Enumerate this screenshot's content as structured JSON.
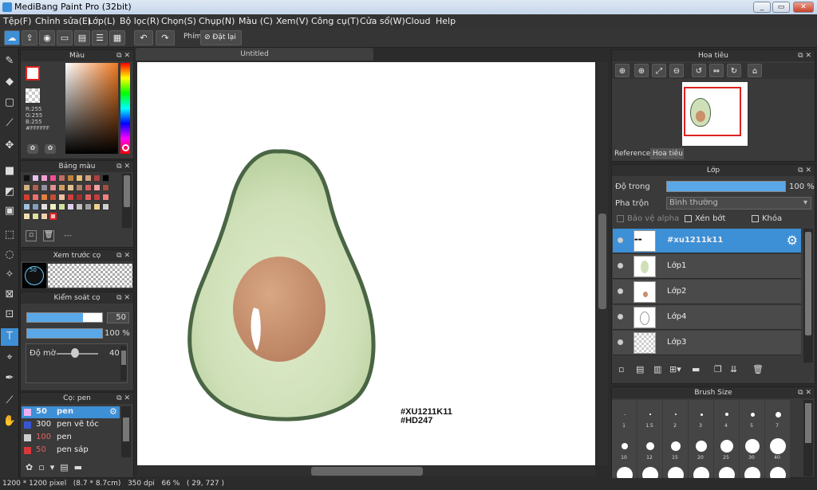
{
  "window": {
    "title": "MediBang Paint Pro (32bit)",
    "min": "_",
    "max": "▭",
    "close": "✕"
  },
  "menu": [
    "Tệp(F)",
    "Chỉnh sửa(E)",
    "Lớp(L)",
    "Bộ lọc(R)",
    "Chọn(S)",
    "Chụp(N)",
    "Màu (C)",
    "Xem(V)",
    "Công cụ(T)",
    "Cửa sổ(W)",
    "Cloud",
    "Help"
  ],
  "toolbar": {
    "key_label": "Phím",
    "reset_label": "Đặt lại"
  },
  "color_panel": {
    "title": "Màu",
    "r": "R:255",
    "g": "G:255",
    "b": "B:255",
    "hex": "#FFFFFF"
  },
  "palette_panel": {
    "title": "Bảng màu",
    "placeholder": "---"
  },
  "brush_preview": {
    "title": "Xem trước cọ",
    "size": "50"
  },
  "brush_control": {
    "title": "Kiểm soát cọ",
    "size": "50",
    "opacity": "100 %",
    "blur_label": "Độ mờ",
    "blur_value": "40"
  },
  "brush_list": {
    "title": "Cọ: pen",
    "items": [
      {
        "size": "50",
        "name": "pen",
        "color": "#f0b0f0"
      },
      {
        "size": "300",
        "name": "pen vẽ tóc",
        "color": "#3a55d0"
      },
      {
        "size": "100",
        "name": "pen",
        "color": "#cccccc"
      },
      {
        "size": "50",
        "name": "pen sáp",
        "color": "#d83838"
      }
    ]
  },
  "canvas": {
    "tab": "Untitled",
    "watermark_1": "#XU1211K11",
    "watermark_2": "#HD247"
  },
  "navigator": {
    "title": "Hoa tiêu",
    "tab_reference": "Reference",
    "tab_navigator": "Hoa tiêu"
  },
  "layer_panel": {
    "title": "Lớp",
    "opacity_label": "Độ trong",
    "opacity_value": "100 %",
    "opacity_fraction": 1.0,
    "blend_label": "Pha trộn",
    "blend_value": "Bình thường",
    "protect_alpha": "Bảo vệ alpha",
    "clipping": "Xén bớt",
    "lock": "Khóa",
    "layers": [
      "#xu1211k11",
      "Lớp1",
      "Lớp2",
      "Lớp4",
      "Lớp3"
    ]
  },
  "brush_size": {
    "title": "Brush Size",
    "row1": [
      "1",
      "1.5",
      "2",
      "3",
      "4",
      "5",
      "7"
    ],
    "row2": [
      "10",
      "12",
      "15",
      "20",
      "25",
      "30",
      "40"
    ]
  },
  "status": "1200 * 1200 pixel   (8.7 * 8.7cm)   350 dpi   66 %   ( 29, 727 )",
  "colors": {
    "accent": "#3d8fd6",
    "avocado_skin": "#4a6544",
    "avocado_flesh": "#cfe0b8",
    "avocado_seed": "#c9906a"
  }
}
